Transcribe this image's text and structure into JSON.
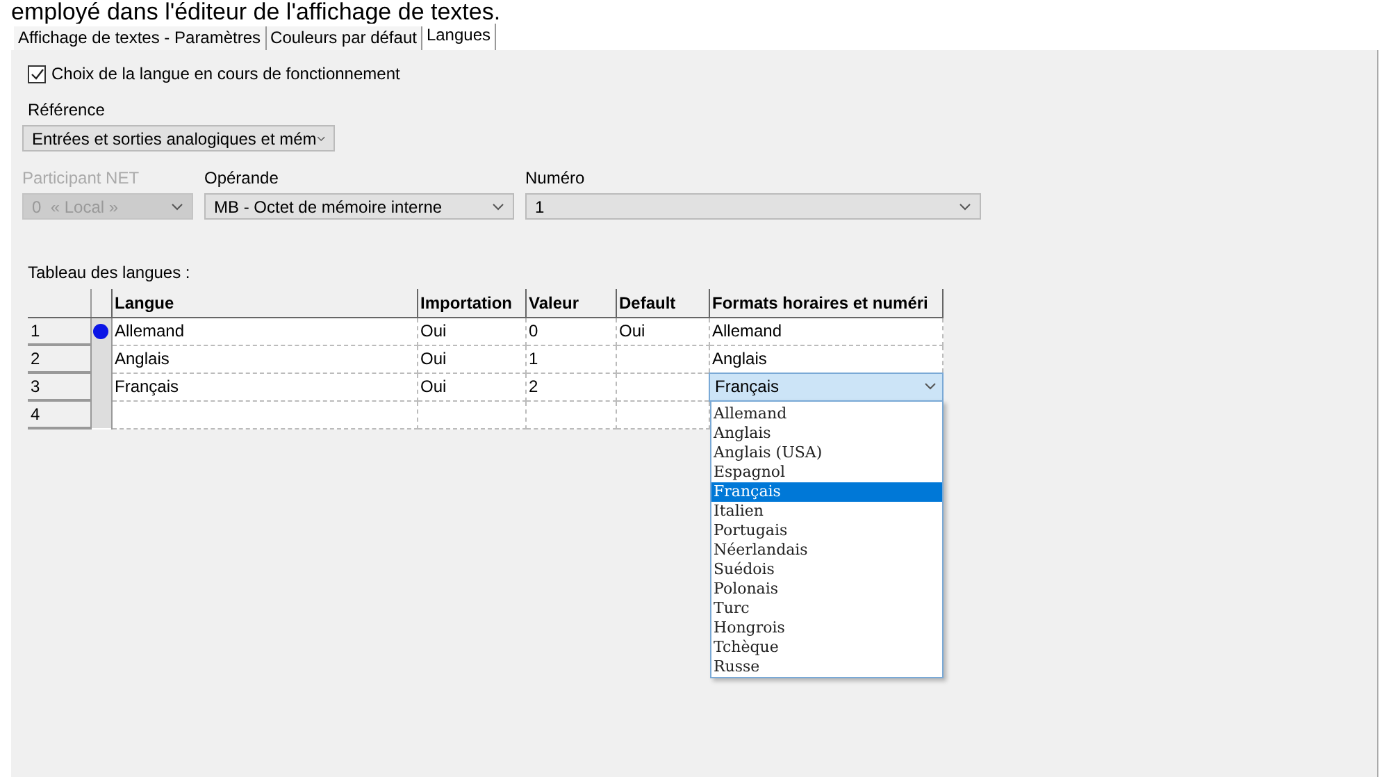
{
  "caption": "employé dans l'éditeur de l'affichage de textes.",
  "tabs": [
    {
      "label": "Affichage de textes - Paramètres",
      "selected": false
    },
    {
      "label": "Couleurs par défaut",
      "selected": false
    },
    {
      "label": "Langues",
      "selected": true
    }
  ],
  "running_language": {
    "label": "Choix de la langue en cours de fonctionnement",
    "checked": true
  },
  "reference": {
    "label": "Référence",
    "value": "Entrées et sorties analogiques et mém"
  },
  "fields": [
    {
      "label": "Participant NET",
      "value": "0  « Local »",
      "disabled": true
    },
    {
      "label": "Opérande",
      "value": "MB - Octet de mémoire interne",
      "disabled": false
    },
    {
      "label": "Numéro",
      "value": "1",
      "disabled": false
    }
  ],
  "table": {
    "title": "Tableau des langues :",
    "columns": [
      "Langue",
      "Importation",
      "Valeur",
      "Default",
      "Formats horaires et numéri"
    ],
    "rows": [
      {
        "number": "1",
        "current": true,
        "editing": false,
        "cells": [
          "Allemand",
          "Oui",
          "0",
          "Oui",
          "Allemand"
        ]
      },
      {
        "number": "2",
        "current": false,
        "editing": false,
        "cells": [
          "Anglais",
          "Oui",
          "1",
          "",
          "Anglais"
        ]
      },
      {
        "number": "3",
        "current": false,
        "editing": true,
        "cells": [
          "Français",
          "Oui",
          "2",
          "",
          "Français"
        ]
      },
      {
        "number": "4",
        "current": false,
        "editing": false
      }
    ],
    "format_options": [
      {
        "label": "Allemand",
        "selected": false
      },
      {
        "label": "Anglais",
        "selected": false
      },
      {
        "label": "Anglais (USA)",
        "selected": false
      },
      {
        "label": "Espagnol",
        "selected": false
      },
      {
        "label": "Français",
        "selected": true
      },
      {
        "label": "Italien",
        "selected": false
      },
      {
        "label": "Portugais",
        "selected": false
      },
      {
        "label": "Néerlandais",
        "selected": false
      },
      {
        "label": "Suédois",
        "selected": false
      },
      {
        "label": "Polonais",
        "selected": false
      },
      {
        "label": "Turc",
        "selected": false
      },
      {
        "label": "Hongrois",
        "selected": false
      },
      {
        "label": "Tchèque",
        "selected": false
      },
      {
        "label": "Russe",
        "selected": false
      }
    ]
  }
}
